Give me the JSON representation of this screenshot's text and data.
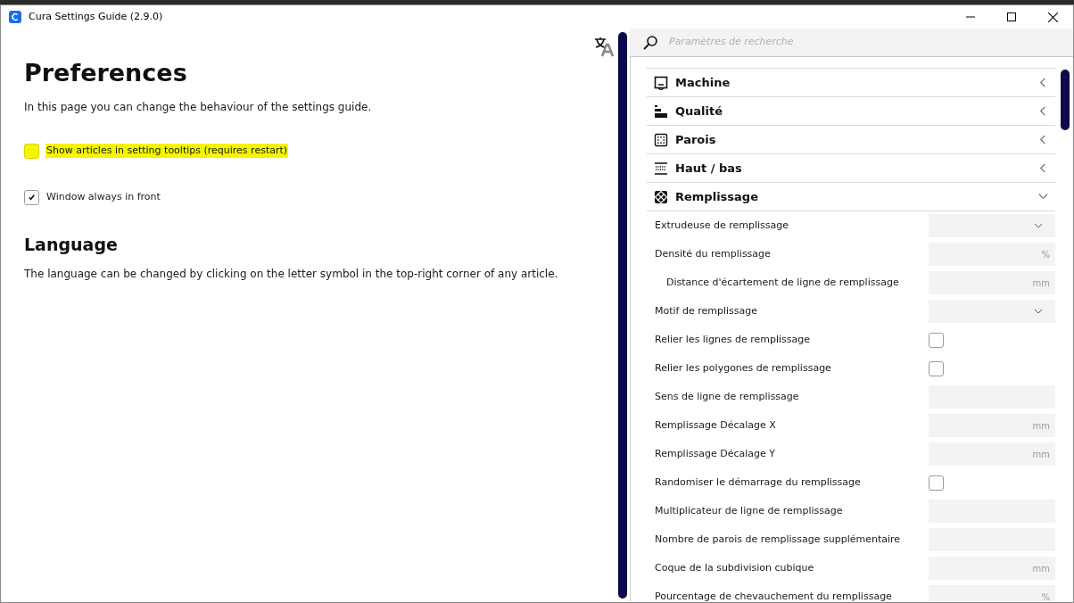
{
  "window": {
    "title": "Cura Settings Guide (2.9.0)"
  },
  "article": {
    "title": "Preferences",
    "intro": "In this page you can change the behaviour of the settings guide.",
    "options": [
      {
        "label": "Show articles in setting tooltips (requires restart)",
        "checked": false,
        "highlighted": true
      },
      {
        "label": "Window always in front",
        "checked": true,
        "highlighted": false
      }
    ],
    "sections": [
      {
        "title": "Language",
        "text": "The language can be changed by clicking on the letter symbol in the top-right corner of any article."
      }
    ]
  },
  "search": {
    "placeholder": "Paramètres de recherche"
  },
  "categories": [
    {
      "label": "Machine",
      "expanded": false
    },
    {
      "label": "Qualité",
      "expanded": false
    },
    {
      "label": "Parois",
      "expanded": false
    },
    {
      "label": "Haut / bas",
      "expanded": false
    },
    {
      "label": "Remplissage",
      "expanded": true
    }
  ],
  "settings": [
    {
      "label": "Extrudeuse de remplissage",
      "kind": "dropdown"
    },
    {
      "label": "Densité du remplissage",
      "kind": "number",
      "unit": "%",
      "children": [
        {
          "label": "Distance d'écartement de ligne de remplissage",
          "kind": "number",
          "unit": "mm"
        }
      ]
    },
    {
      "label": "Motif de remplissage",
      "kind": "dropdown"
    },
    {
      "label": "Relier les lignes de remplissage",
      "kind": "checkbox",
      "checked": false
    },
    {
      "label": "Relier les polygones de remplissage",
      "kind": "checkbox",
      "checked": false
    },
    {
      "label": "Sens de ligne de remplissage",
      "kind": "text"
    },
    {
      "label": "Remplissage Décalage X",
      "kind": "number",
      "unit": "mm"
    },
    {
      "label": "Remplissage Décalage Y",
      "kind": "number",
      "unit": "mm"
    },
    {
      "label": "Randomiser le démarrage du remplissage",
      "kind": "checkbox",
      "checked": false
    },
    {
      "label": "Multiplicateur de ligne de remplissage",
      "kind": "text"
    },
    {
      "label": "Nombre de parois de remplissage supplémentaire",
      "kind": "text"
    },
    {
      "label": "Coque de la subdivision cubique",
      "kind": "number",
      "unit": "mm"
    },
    {
      "label": "Pourcentage de chevauchement du remplissage",
      "kind": "number",
      "unit": "%"
    }
  ]
}
